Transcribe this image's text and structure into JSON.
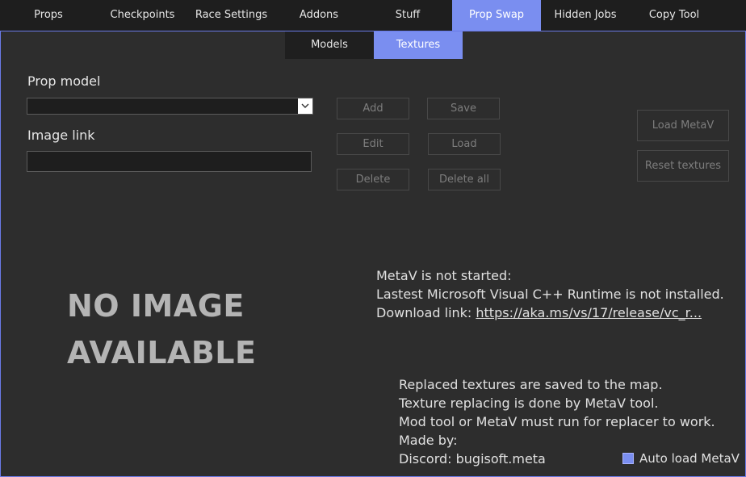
{
  "tabs": [
    {
      "label": "Props",
      "active": false
    },
    {
      "label": "Checkpoints",
      "active": false
    },
    {
      "label": "Race Settings",
      "active": false
    },
    {
      "label": "Addons",
      "active": false
    },
    {
      "label": "Stuff",
      "active": false
    },
    {
      "label": "Prop Swap",
      "active": true
    },
    {
      "label": "Hidden Jobs",
      "active": false
    },
    {
      "label": "Copy Tool",
      "active": false
    }
  ],
  "subtabs": [
    {
      "label": "Models",
      "active": false
    },
    {
      "label": "Textures",
      "active": true
    }
  ],
  "form": {
    "prop_model_label": "Prop model",
    "prop_model_value": "",
    "image_link_label": "Image link",
    "image_link_value": ""
  },
  "buttons": {
    "add": "Add",
    "save": "Save",
    "edit": "Edit",
    "load": "Load",
    "delete": "Delete",
    "delete_all": "Delete all",
    "load_metav": "Load MetaV",
    "reset_textures": "Reset textures"
  },
  "preview": {
    "line1": "NO IMAGE",
    "line2": "AVAILABLE"
  },
  "status": {
    "line1": "MetaV is not started:",
    "line2": "Lastest Microsoft Visual C++ Runtime is not installed.",
    "line3_prefix": "Download link: ",
    "link_text": "https://aka.ms/vs/17/release/vc_r..."
  },
  "notes": [
    "Replaced textures are saved to the map.",
    "Texture replacing is done by MetaV tool.",
    "Mod tool or MetaV must run for replacer to work.",
    "Made by:",
    "Discord: bugisoft.meta"
  ],
  "auto_load": {
    "label": "Auto load MetaV",
    "checked": true
  },
  "colors": {
    "accent": "#7a8ef0",
    "background": "#2d2d2d",
    "tabbar": "#1e1e1e"
  }
}
